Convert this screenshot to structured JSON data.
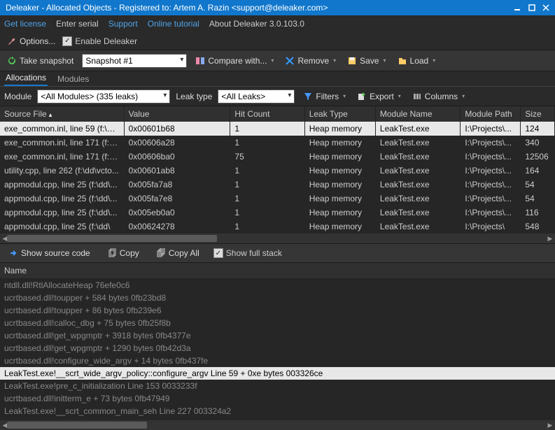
{
  "titlebar": {
    "text": "Deleaker - Allocated Objects - Registered to: Artem A. Razin <support@deleaker.com>"
  },
  "menubar": {
    "get_license": "Get license",
    "enter_serial": "Enter serial",
    "support": "Support",
    "online_tutorial": "Online tutorial",
    "about": "About Deleaker 3.0.103.0"
  },
  "toolbar1": {
    "options": "Options...",
    "enable": "Enable Deleaker"
  },
  "toolbar2": {
    "take_snapshot": "Take snapshot",
    "snapshot_value": "Snapshot #1",
    "compare": "Compare with...",
    "remove": "Remove",
    "save": "Save",
    "load": "Load"
  },
  "tabs": {
    "allocations": "Allocations",
    "modules": "Modules"
  },
  "filterbar": {
    "module_lbl": "Module",
    "module_value": "<All Modules> (335 leaks)",
    "leak_type_lbl": "Leak type",
    "leak_type_value": "<All Leaks>",
    "filters": "Filters",
    "export": "Export",
    "columns": "Columns"
  },
  "columns": {
    "source": "Source File",
    "value": "Value",
    "hit": "Hit Count",
    "leak": "Leak Type",
    "module": "Module Name",
    "path": "Module Path",
    "size": "Size"
  },
  "rows": [
    {
      "src": "exe_common.inl, line 59 (f:\\dd\\...",
      "val": "0x00601b68",
      "hit": "1",
      "leak": "Heap memory",
      "mod": "LeakTest.exe",
      "path": "I:\\Projects\\...",
      "size": "124",
      "sel": true
    },
    {
      "src": "exe_common.inl, line 171 (f:\\d...",
      "val": "0x00606a28",
      "hit": "1",
      "leak": "Heap memory",
      "mod": "LeakTest.exe",
      "path": "I:\\Projects\\...",
      "size": "340"
    },
    {
      "src": "exe_common.inl, line 171 (f:\\d...",
      "val": "0x00606ba0",
      "hit": "75",
      "leak": "Heap memory",
      "mod": "LeakTest.exe",
      "path": "I:\\Projects\\...",
      "size": "12506"
    },
    {
      "src": "utility.cpp, line 262 (f:\\dd\\vcto...",
      "val": "0x00601ab8",
      "hit": "1",
      "leak": "Heap memory",
      "mod": "LeakTest.exe",
      "path": "I:\\Projects\\...",
      "size": "164"
    },
    {
      "src": "appmodul.cpp, line 25 (f:\\dd\\...",
      "val": "0x005fa7a8",
      "hit": "1",
      "leak": "Heap memory",
      "mod": "LeakTest.exe",
      "path": "I:\\Projects\\...",
      "size": "54"
    },
    {
      "src": "appmodul.cpp, line 25 (f:\\dd\\...",
      "val": "0x005fa7e8",
      "hit": "1",
      "leak": "Heap memory",
      "mod": "LeakTest.exe",
      "path": "I:\\Projects\\...",
      "size": "54"
    },
    {
      "src": "appmodul.cpp, line 25 (f:\\dd\\...",
      "val": "0x005eb0a0",
      "hit": "1",
      "leak": "Heap memory",
      "mod": "LeakTest.exe",
      "path": "I:\\Projects\\...",
      "size": "116"
    },
    {
      "src": "appmodul.cpp, line 25 (f:\\dd\\",
      "val": "0x00624278",
      "hit": "1",
      "leak": "Heap memory",
      "mod": "LeakTest.exe",
      "path": "I:\\Projects\\",
      "size": "548"
    }
  ],
  "midbar": {
    "show_source": "Show source code",
    "copy": "Copy",
    "copy_all": "Copy All",
    "show_full_stack": "Show full stack"
  },
  "stack_header": "Name",
  "stack": [
    {
      "t": "ntdll.dll!RtlAllocateHeap 76efe0c6"
    },
    {
      "t": "ucrtbased.dll!toupper + 584 bytes 0fb23bd8"
    },
    {
      "t": "ucrtbased.dll!toupper + 86 bytes 0fb239e6"
    },
    {
      "t": "ucrtbased.dll!calloc_dbg + 75 bytes 0fb25f8b"
    },
    {
      "t": "ucrtbased.dll!get_wpgmptr + 3918 bytes 0fb4377e"
    },
    {
      "t": "ucrtbased.dll!get_wpgmptr + 1290 bytes 0fb42d3a"
    },
    {
      "t": "ucrtbased.dll!configure_wide_argv + 14 bytes 0fb437fe"
    },
    {
      "t": "LeakTest.exe!__scrt_wide_argv_policy::configure_argv Line 59 + 0xe bytes 003326ce",
      "sel": true
    },
    {
      "t": "LeakTest.exe!pre_c_initialization Line 153 0033233f"
    },
    {
      "t": "ucrtbased.dll!initterm_e + 73 bytes 0fb47949"
    },
    {
      "t": "LeakTest.exe!__scrt_common_main_seh Line 227 003324a2"
    }
  ]
}
